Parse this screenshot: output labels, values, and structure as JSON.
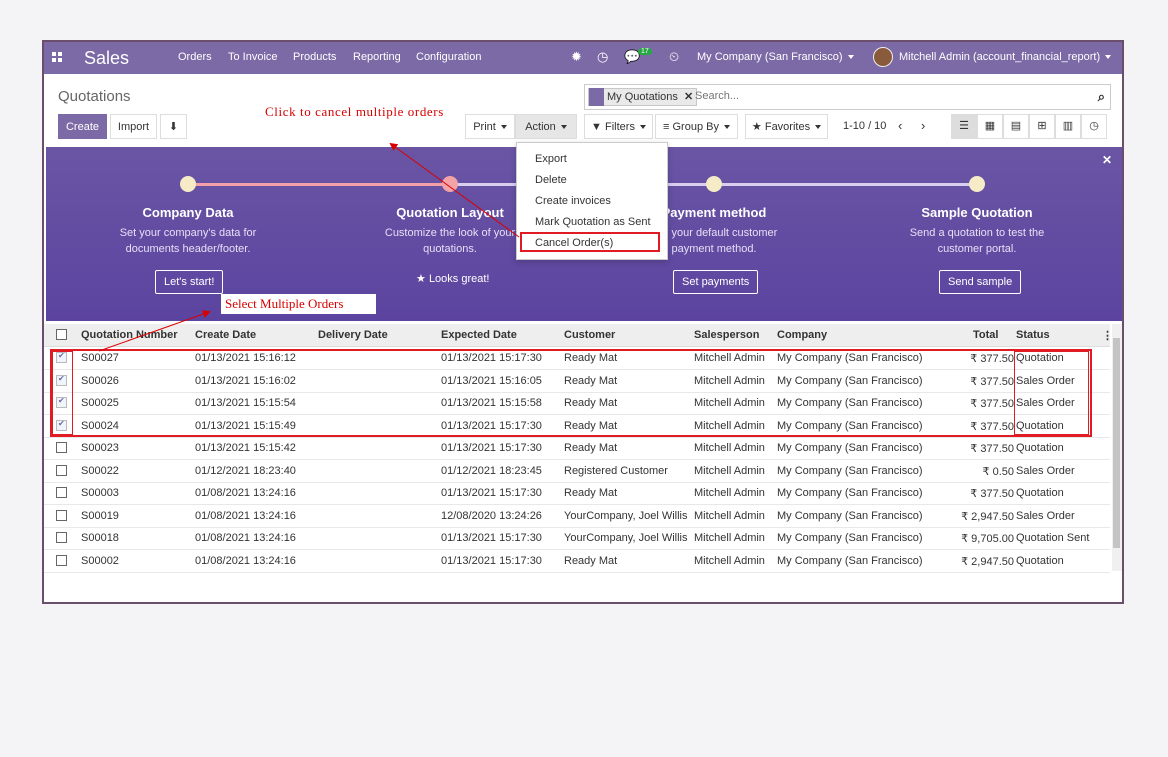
{
  "nav": {
    "brand": "Sales",
    "menu": [
      "Orders",
      "To Invoice",
      "Products",
      "Reporting",
      "Configuration"
    ],
    "messages_count": "17",
    "company": "My Company (San Francisco)",
    "user": "Mitchell Admin (account_financial_report)"
  },
  "control": {
    "title": "Quotations",
    "create_label": "Create",
    "import_label": "Import",
    "print_label": "Print",
    "action_label": "Action",
    "search_facet": "My Quotations",
    "search_placeholder": "Search...",
    "filters_label": "Filters",
    "groupby_label": "Group By",
    "favorites_label": "Favorites",
    "pager": "1-10 / 10"
  },
  "action_menu": [
    "Export",
    "Delete",
    "Create invoices",
    "Mark Quotation as Sent",
    "Cancel Order(s)"
  ],
  "onboarding": {
    "steps": [
      {
        "title": "Company Data",
        "desc1": "Set your company's data for",
        "desc2": "documents header/footer.",
        "button": "Let's start!"
      },
      {
        "title": "Quotation Layout",
        "desc1": "Customize the look of your",
        "desc2": "quotations.",
        "button": "Looks great!"
      },
      {
        "title": "Payment method",
        "desc1": "ose your default customer",
        "desc2": "payment method.",
        "button": "Set payments"
      },
      {
        "title": "Sample Quotation",
        "desc1": "Send a quotation to test the",
        "desc2": "customer portal.",
        "button": "Send sample"
      }
    ]
  },
  "annotations": {
    "cancel_note": "Click to cancel multiple orders",
    "select_note": "Select Multiple Orders"
  },
  "table": {
    "headers": [
      "Quotation Number",
      "Create Date",
      "Delivery Date",
      "Expected Date",
      "Customer",
      "Salesperson",
      "Company",
      "Total",
      "Status"
    ],
    "rows": [
      {
        "checked": true,
        "number": "S00027",
        "create": "01/13/2021 15:16:12",
        "delivery": "",
        "expected": "01/13/2021 15:17:30",
        "customer": "Ready Mat",
        "salesperson": "Mitchell Admin",
        "company": "My Company (San Francisco)",
        "total": "₹ 377.50",
        "status": "Quotation"
      },
      {
        "checked": true,
        "number": "S00026",
        "create": "01/13/2021 15:16:02",
        "delivery": "",
        "expected": "01/13/2021 15:16:05",
        "customer": "Ready Mat",
        "salesperson": "Mitchell Admin",
        "company": "My Company (San Francisco)",
        "total": "₹ 377.50",
        "status": "Sales Order"
      },
      {
        "checked": true,
        "number": "S00025",
        "create": "01/13/2021 15:15:54",
        "delivery": "",
        "expected": "01/13/2021 15:15:58",
        "customer": "Ready Mat",
        "salesperson": "Mitchell Admin",
        "company": "My Company (San Francisco)",
        "total": "₹ 377.50",
        "status": "Sales Order"
      },
      {
        "checked": true,
        "number": "S00024",
        "create": "01/13/2021 15:15:49",
        "delivery": "",
        "expected": "01/13/2021 15:17:30",
        "customer": "Ready Mat",
        "salesperson": "Mitchell Admin",
        "company": "My Company (San Francisco)",
        "total": "₹ 377.50",
        "status": "Quotation"
      },
      {
        "checked": false,
        "number": "S00023",
        "create": "01/13/2021 15:15:42",
        "delivery": "",
        "expected": "01/13/2021 15:17:30",
        "customer": "Ready Mat",
        "salesperson": "Mitchell Admin",
        "company": "My Company (San Francisco)",
        "total": "₹ 377.50",
        "status": "Quotation"
      },
      {
        "checked": false,
        "number": "S00022",
        "create": "01/12/2021 18:23:40",
        "delivery": "",
        "expected": "01/12/2021 18:23:45",
        "customer": "Registered Customer",
        "salesperson": "Mitchell Admin",
        "company": "My Company (San Francisco)",
        "total": "₹ 0.50",
        "status": "Sales Order"
      },
      {
        "checked": false,
        "number": "S00003",
        "create": "01/08/2021 13:24:16",
        "delivery": "",
        "expected": "01/13/2021 15:17:30",
        "customer": "Ready Mat",
        "salesperson": "Mitchell Admin",
        "company": "My Company (San Francisco)",
        "total": "₹ 377.50",
        "status": "Quotation"
      },
      {
        "checked": false,
        "number": "S00019",
        "create": "01/08/2021 13:24:16",
        "delivery": "",
        "expected": "12/08/2020 13:24:26",
        "customer": "YourCompany, Joel Willis",
        "salesperson": "Mitchell Admin",
        "company": "My Company (San Francisco)",
        "total": "₹ 2,947.50",
        "status": "Sales Order"
      },
      {
        "checked": false,
        "number": "S00018",
        "create": "01/08/2021 13:24:16",
        "delivery": "",
        "expected": "01/13/2021 15:17:30",
        "customer": "YourCompany, Joel Willis",
        "salesperson": "Mitchell Admin",
        "company": "My Company (San Francisco)",
        "total": "₹ 9,705.00",
        "status": "Quotation Sent"
      },
      {
        "checked": false,
        "number": "S00002",
        "create": "01/08/2021 13:24:16",
        "delivery": "",
        "expected": "01/13/2021 15:17:30",
        "customer": "Ready Mat",
        "salesperson": "Mitchell Admin",
        "company": "My Company (San Francisco)",
        "total": "₹ 2,947.50",
        "status": "Quotation"
      }
    ]
  },
  "colors": {
    "brand": "#7c6aa6",
    "annotation": "#e01b24"
  }
}
